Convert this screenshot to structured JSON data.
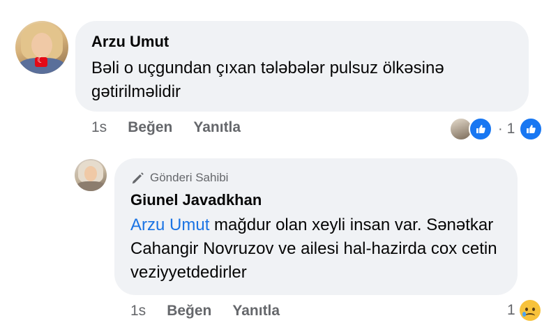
{
  "comment": {
    "author": "Arzu Umut",
    "text": "Bəli o uçgundan çıxan tələbələr pulsuz ölkəsinə gətirilməlidir",
    "time": "1s",
    "like_label": "Beğen",
    "reply_label": "Yanıtla",
    "reaction_separator": "·",
    "reaction_count": "1"
  },
  "reply": {
    "badge": "Gönderi Sahibi",
    "author": "Giunel Javadkhan",
    "mention": "Arzu Umut",
    "text": " mağdur olan xeyli insan var. Sənətkar Cahangir Novruzov ve ailesi hal-hazirda cox cetin veziyyetdedirler",
    "time": "1s",
    "like_label": "Beğen",
    "reply_label": "Yanıtla",
    "reaction_count": "1"
  },
  "colors": {
    "accent": "#1877f2",
    "mention": "#1b74e4",
    "bubble": "#f0f2f5",
    "muted": "#65676b"
  },
  "icons": {
    "like": "like-icon",
    "sad": "sad-reaction-icon",
    "owner": "pen-icon"
  }
}
